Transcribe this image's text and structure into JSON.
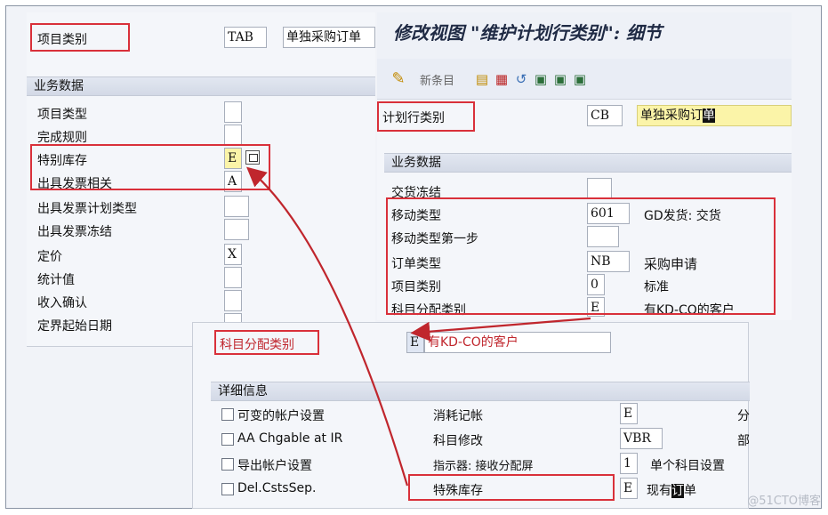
{
  "left_panel": {
    "item_category_label": "项目类别",
    "item_category_code": "TAB",
    "item_category_desc": "单独采购订单",
    "group_title": "业务数据",
    "rows": [
      {
        "label": "项目类型",
        "value": ""
      },
      {
        "label": "完成规则",
        "value": ""
      },
      {
        "label": "特别库存",
        "value": "E"
      },
      {
        "label": "出具发票相关",
        "value": "A"
      },
      {
        "label": "出具发票计划类型",
        "value": ""
      },
      {
        "label": "出具发票冻结",
        "value": ""
      },
      {
        "label": "定价",
        "value": "X"
      },
      {
        "label": "统计值",
        "value": ""
      },
      {
        "label": "收入确认",
        "value": ""
      },
      {
        "label": "定界起始日期",
        "value": ""
      }
    ]
  },
  "right_panel": {
    "title": "修改视图 \"维护计划行类别\": 细节",
    "toolbar": {
      "new_entries_label": "新条目"
    },
    "schedule_line_label": "计划行类别",
    "schedule_line_code": "CB",
    "schedule_line_desc_prefix": "单独采购订",
    "schedule_line_desc_cursor": "单",
    "group_title": "业务数据",
    "rows": [
      {
        "label": "交货冻结",
        "value": "",
        "desc": ""
      },
      {
        "label": "移动类型",
        "value": "601",
        "desc": "GD发货: 交货"
      },
      {
        "label": "移动类型第一步",
        "value": "",
        "desc": ""
      },
      {
        "label": "订单类型",
        "value": "NB",
        "desc": "采购申请"
      },
      {
        "label": "项目类别",
        "value": "0",
        "desc": "标准"
      },
      {
        "label": "科目分配类别",
        "value": "E",
        "desc": "有KD-CO的客户"
      }
    ]
  },
  "bottom_panel": {
    "acct_assign_label": "科目分配类别",
    "acct_assign_code": "E",
    "acct_assign_desc": "有KD-CO的客户",
    "group_title": "详细信息",
    "checkboxes": [
      {
        "label": "可变的帐户设置"
      },
      {
        "label": "AA Chgable at IR"
      },
      {
        "label": "导出帐户设置"
      },
      {
        "label": "Del.CstsSep."
      }
    ],
    "fields": [
      {
        "label": "消耗记帐",
        "value": "E",
        "desc": "",
        "trail": "分"
      },
      {
        "label": "科目修改",
        "value": "VBR",
        "desc": "",
        "trail": "部"
      },
      {
        "label": "指示器: 接收分配屏",
        "value": "1",
        "desc": "单个科目设置",
        "trail": ""
      },
      {
        "label": "特殊库存",
        "value": "E",
        "desc_prefix": "现有",
        "desc_cursor": "订",
        "desc_suffix": "单",
        "trail": ""
      }
    ]
  },
  "watermark": "@51CTO博客",
  "colors": {
    "highlight_border": "#d9303a",
    "arrow": "#c0262d",
    "input_yellow": "#fbf4a8"
  }
}
